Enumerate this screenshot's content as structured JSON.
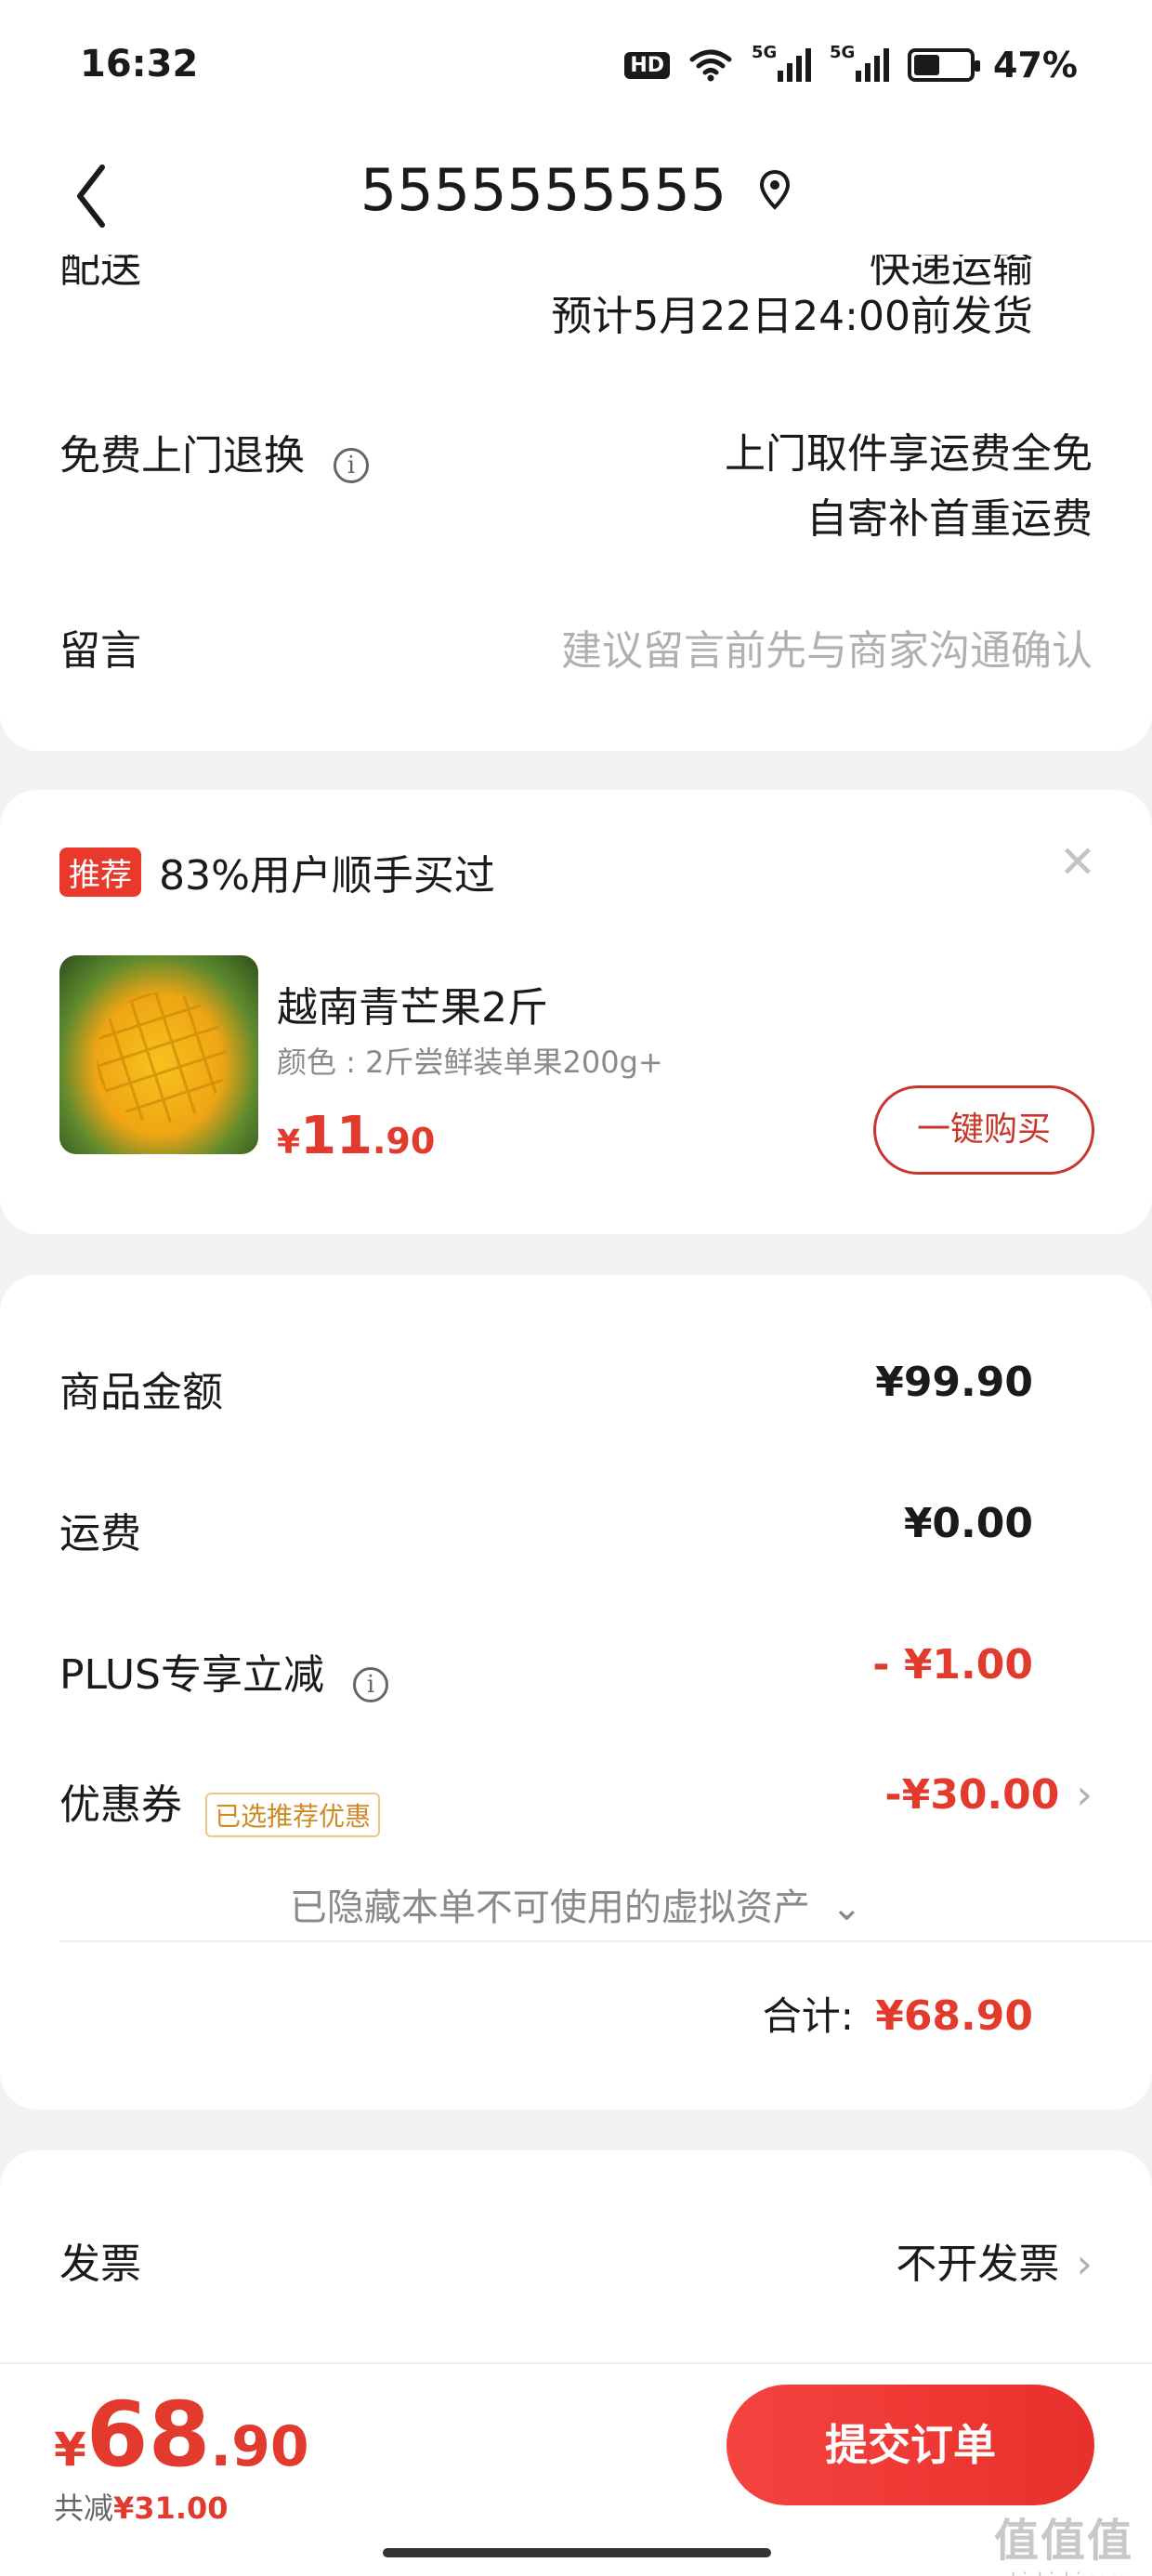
{
  "status_bar": {
    "time": "16:32",
    "hd": "HD",
    "net1": "5G",
    "net2": "5G",
    "battery": "47%",
    "battery_level": 0.47
  },
  "nav": {
    "title": "5555555555"
  },
  "delivery": {
    "label_cut": "配送",
    "value_cut": "快递运输",
    "ship_time": "预计5月22日24:00前发货"
  },
  "return_service": {
    "label": "免费上门退换",
    "line1": "上门取件享运费全免",
    "line2": "自寄补首重运费"
  },
  "message": {
    "label": "留言",
    "placeholder": "建议留言前先与商家沟通确认"
  },
  "recommend": {
    "badge": "推荐",
    "title": "83%用户顺手买过",
    "product": {
      "name": "越南青芒果2斤",
      "spec": "颜色 : 2斤尝鲜装单果200g+",
      "currency": "¥",
      "price_int": "11",
      "price_dec": ".90"
    },
    "buy_button": "一键购买"
  },
  "price_detail": {
    "goods_label": "商品金额",
    "goods_value": "¥99.90",
    "shipping_label": "运费",
    "shipping_value": "¥0.00",
    "plus_label": "PLUS专享立减",
    "plus_value": "- ¥1.00",
    "coupon_label": "优惠券",
    "coupon_tag": "已选推荐优惠",
    "coupon_value": "-¥30.00",
    "hidden_assets": "已隐藏本单不可使用的虚拟资产",
    "total_label": "合计:",
    "total_value": "¥68.90"
  },
  "invoice": {
    "label": "发票",
    "value": "不开发票"
  },
  "bottom_bar": {
    "currency": "¥",
    "price_int": "68",
    "price_dec": ".90",
    "save_label": "共减",
    "save_value": "¥31.00",
    "submit": "提交订单"
  },
  "watermark": {
    "logo": "值值值",
    "site": "zhizhizhi.com"
  },
  "colors": {
    "accent": "#e23b2e",
    "badge": "#e8392c",
    "coupon": "#d08a23",
    "background": "#f2f2f2"
  }
}
